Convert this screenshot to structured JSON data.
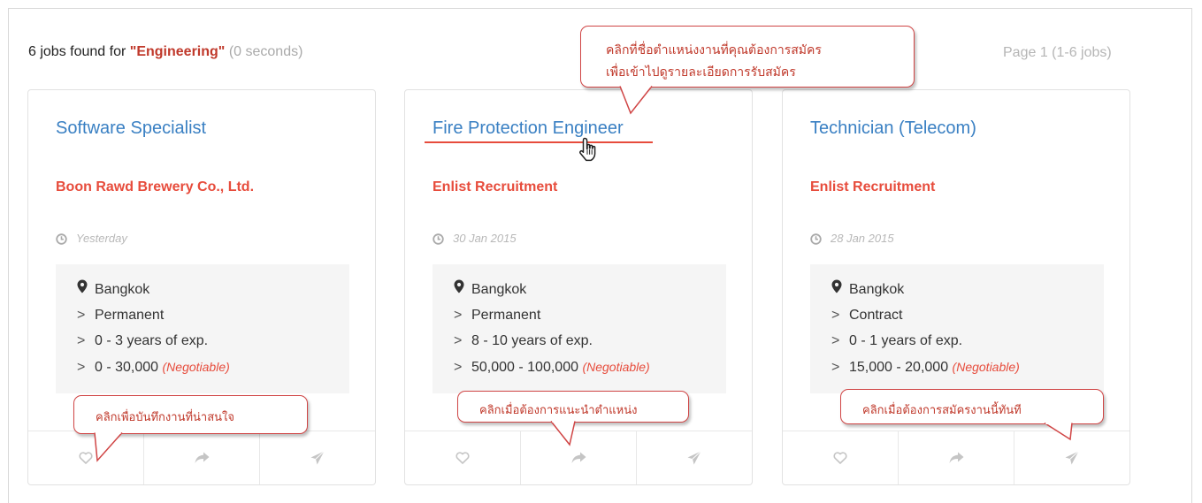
{
  "search": {
    "count_text": "6 jobs found for",
    "query": "\"Engineering\"",
    "time_text": "(0 seconds)",
    "page_text": "Page 1 (1-6 jobs)"
  },
  "jobs": [
    {
      "title": "Software Specialist",
      "company": "Boon Rawd Brewery Co., Ltd.",
      "date": "Yesterday",
      "location": "Bangkok",
      "type": "Permanent",
      "experience": "0 - 3 years of exp.",
      "salary": "0 - 30,000",
      "negotiable": "(Negotiable)"
    },
    {
      "title": "Fire Protection Engineer",
      "company": "Enlist Recruitment",
      "date": "30 Jan 2015",
      "location": "Bangkok",
      "type": "Permanent",
      "experience": "8 - 10 years of exp.",
      "salary": "50,000 - 100,000",
      "negotiable": "(Negotiable)"
    },
    {
      "title": "Technician (Telecom)",
      "company": "Enlist Recruitment",
      "date": "28 Jan 2015",
      "location": "Bangkok",
      "type": "Contract",
      "experience": "0 - 1 years of exp.",
      "salary": "15,000 - 20,000",
      "negotiable": "(Negotiable)"
    }
  ],
  "callouts": {
    "title_hint_line1": "คลิกที่ชื่อตำแหน่งงานที่คุณต้องการสมัคร",
    "title_hint_line2": "เพื่อเข้าไปดูรายละเอียดการรับสมัคร",
    "save_hint": "คลิกเพื่อบันทึกงานที่น่าสนใจ",
    "recommend_hint": "คลิกเมื่อต้องการแนะนำตำแหน่ง",
    "apply_hint": "คลิกเมื่อต้องการสมัครงานนี้ทันที"
  },
  "colors": {
    "title_link": "#3a80c3",
    "company": "#e74c3c",
    "callout_border": "#d04545",
    "query": "#c0392b"
  },
  "icons": {
    "date": "clock-icon",
    "location": "map-marker-icon",
    "detail_bullet": "chevron-right-icon",
    "save": "heart-icon",
    "share": "share-arrow-icon",
    "apply": "paper-plane-icon",
    "pointer": "hand-pointer-icon"
  }
}
